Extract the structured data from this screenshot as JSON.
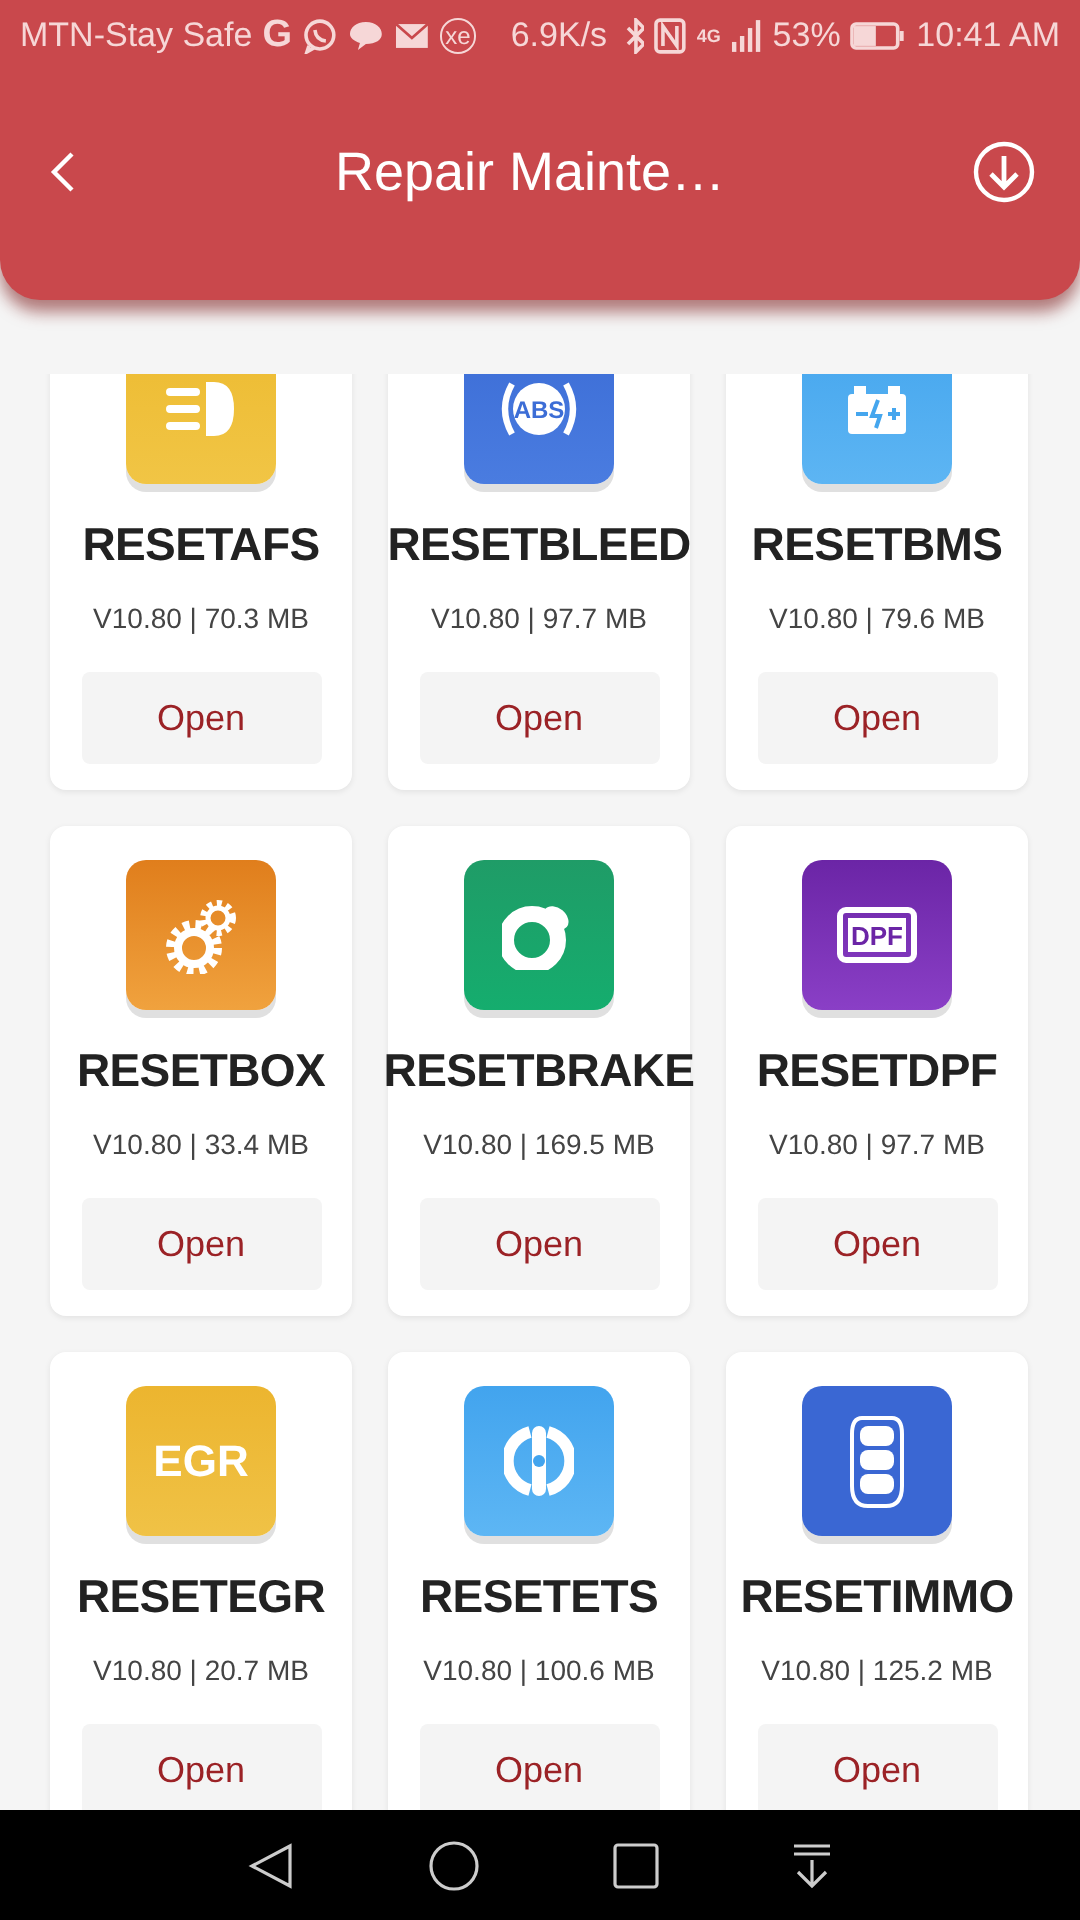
{
  "status_bar": {
    "carrier": "MTN-Stay Safe",
    "google_mark": "G",
    "currency_mark": "xe",
    "speed": "6.9K/s",
    "network_type": "4G",
    "battery": "53%",
    "time": "10:41 AM"
  },
  "header": {
    "title": "Repair Mainte…"
  },
  "apps": [
    {
      "name": "RESETAFS",
      "info": "V10.80 | 70.3 MB",
      "button": "Open",
      "kind": "headlight"
    },
    {
      "name": "RESETBLEED",
      "info": "V10.80 | 97.7 MB",
      "button": "Open",
      "kind": "abs",
      "icon_text": "ABS"
    },
    {
      "name": "RESETBMS",
      "info": "V10.80 | 79.6 MB",
      "button": "Open",
      "kind": "battery"
    },
    {
      "name": "RESETBOX",
      "info": "V10.80 | 33.4 MB",
      "button": "Open",
      "kind": "gears"
    },
    {
      "name": "RESETBRAKE",
      "info": "V10.80 | 169.5 MB",
      "button": "Open",
      "kind": "brake"
    },
    {
      "name": "RESETDPF",
      "info": "V10.80 | 97.7 MB",
      "button": "Open",
      "kind": "dpf",
      "icon_text": "DPF"
    },
    {
      "name": "RESETEGR",
      "info": "V10.80 | 20.7 MB",
      "button": "Open",
      "kind": "egr",
      "icon_text": "EGR"
    },
    {
      "name": "RESETETS",
      "info": "V10.80 | 100.6 MB",
      "button": "Open",
      "kind": "ets"
    },
    {
      "name": "RESETIMMO",
      "info": "V10.80 | 125.2 MB",
      "button": "Open",
      "kind": "immo"
    }
  ]
}
